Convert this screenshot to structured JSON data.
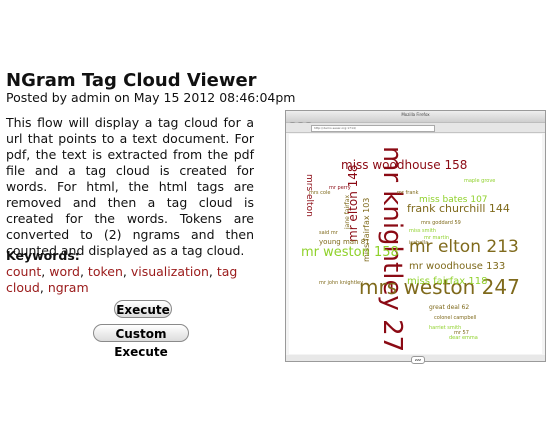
{
  "post": {
    "title": "NGram Tag Cloud Viewer",
    "posted": "Posted by admin on May 15 2012 08:46:04pm",
    "description": "This flow will display a tag cloud for a url that points to a text document. For pdf, the text is extracted from the pdf file and a tag cloud is created for words. For html, the html tags are removed and then a tag cloud is created for the words. Tokens are converted to (2) ngrams and then counted and displayed as a tag cloud."
  },
  "keywords": {
    "label": "Keywords:",
    "items": [
      "count",
      "word",
      "token",
      "visualization",
      "tag cloud",
      "ngram"
    ],
    "sep": ", "
  },
  "buttons": {
    "execute": "Execute",
    "custom_execute": "Custom Execute"
  },
  "preview": {
    "window_title": "Mozilla Firefox",
    "url": "http://demo.seasr.org:1714/",
    "status_button": "ZZZ",
    "colors": {
      "green": "#8fd12a",
      "darkred": "#8b0a14",
      "olive": "#7f6a1c"
    },
    "cloud_words": [
      {
        "text": "mr knightley 277",
        "color": "darkred"
      },
      {
        "text": "mrs weston 247",
        "color": "olive"
      },
      {
        "text": "mr elton 213",
        "color": "olive"
      },
      {
        "text": "miss woodhouse 158",
        "color": "darkred"
      },
      {
        "text": "mr weston 158",
        "color": "green"
      },
      {
        "text": "mr elton 148",
        "color": "darkred"
      },
      {
        "text": "frank churchill 144",
        "color": "olive"
      },
      {
        "text": "mr woodhouse 133",
        "color": "olive"
      },
      {
        "text": "miss fairfax 118",
        "color": "green"
      },
      {
        "text": "miss bates 107",
        "color": "green"
      },
      {
        "text": "miss fairfax 103",
        "color": "olive"
      },
      {
        "text": "mrs elton",
        "color": "darkred"
      },
      {
        "text": "young man 81",
        "color": "olive"
      },
      {
        "text": "jane fairfax",
        "color": "olive"
      },
      {
        "text": "great deal 62",
        "color": "olive"
      },
      {
        "text": "mrs goddard 59",
        "color": "olive"
      },
      {
        "text": "miss smith",
        "color": "green"
      },
      {
        "text": "mr frank",
        "color": "olive"
      },
      {
        "text": "mr martin",
        "color": "green"
      },
      {
        "text": "colonel campbell",
        "color": "olive"
      },
      {
        "text": "mr john knightley",
        "color": "olive"
      },
      {
        "text": "harriet smith",
        "color": "green"
      },
      {
        "text": "mrs cole",
        "color": "olive"
      },
      {
        "text": "maple grove",
        "color": "green"
      },
      {
        "text": "mr perry",
        "color": "darkred"
      },
      {
        "text": "said mr",
        "color": "olive"
      },
      {
        "text": "dear emma",
        "color": "green"
      },
      {
        "text": "isabella",
        "color": "olive"
      },
      {
        "text": "mr 57",
        "color": "olive"
      }
    ]
  }
}
